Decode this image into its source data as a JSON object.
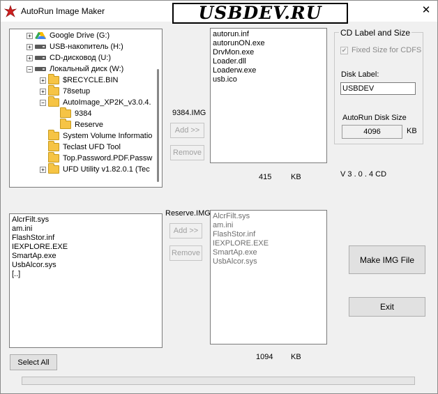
{
  "window": {
    "title": "AutoRun Image Maker",
    "logo_text": "USBDEV.RU",
    "close_symbol": "✕"
  },
  "colors": {
    "accent_red": "#cc1f1f",
    "folder": "#f6c445"
  },
  "tree": [
    {
      "label": "Google Drive (G:)",
      "icon": "google-drive-icon",
      "expander": "+"
    },
    {
      "label": "USB-накопитель (H:)",
      "icon": "usb-drive-icon",
      "expander": "+"
    },
    {
      "label": "CD-дисковод (U:)",
      "icon": "cd-drive-icon",
      "expander": "+"
    },
    {
      "label": "Локальный диск (W:)",
      "icon": "local-disk-icon",
      "expander": "-"
    },
    {
      "label": "$RECYCLE.BIN",
      "icon": "folder-icon",
      "expander": "+"
    },
    {
      "label": "78setup",
      "icon": "folder-icon",
      "expander": "+"
    },
    {
      "label": "AutoImage_XP2K_v3.0.4.",
      "icon": "folder-open-icon",
      "expander": "-"
    },
    {
      "label": "9384",
      "icon": "folder-icon",
      "expander": ""
    },
    {
      "label": "Reserve",
      "icon": "folder-icon",
      "expander": ""
    },
    {
      "label": "System Volume Informatio",
      "icon": "folder-icon",
      "expander": ""
    },
    {
      "label": "Teclast UFD Tool",
      "icon": "folder-icon",
      "expander": ""
    },
    {
      "label": "Top.Password.PDF.Passw",
      "icon": "folder-icon",
      "expander": ""
    },
    {
      "label": "UFD Utility v1.82.0.1 (Tec",
      "icon": "folder-icon",
      "expander": "+"
    }
  ],
  "top_image": {
    "label": "9384.IMG",
    "add_label": "Add >>",
    "remove_label": "Remove",
    "files": [
      "autorun.inf",
      "autorunON.exe",
      "DrvMon.exe",
      "Loader.dll",
      "Loaderw.exe",
      "usb.ico"
    ],
    "size": "415",
    "unit": "KB"
  },
  "bottom_image": {
    "label": "Reserve.IMG",
    "add_label": "Add >>",
    "remove_label": "Remove",
    "files": [
      "AlcrFilt.sys",
      "am.ini",
      "FlashStor.inf",
      "IEXPLORE.EXE",
      "SmartAp.exe",
      "UsbAlcor.sys"
    ],
    "size": "1094",
    "unit": "KB"
  },
  "source_files": [
    "AlcrFilt.sys",
    "am.ini",
    "FlashStor.inf",
    "IEXPLORE.EXE",
    "SmartAp.exe",
    "UsbAlcor.sys",
    "[..]"
  ],
  "cd_group": {
    "title": "CD Label and Size",
    "fixed_size_label": "Fixed Size for CDFS",
    "fixed_size_checked": true,
    "disk_label_caption": "Disk Label:",
    "disk_label_value": "USBDEV",
    "disk_size_caption": "AutoRun Disk Size",
    "disk_size_value": "4096",
    "disk_size_unit": "KB"
  },
  "version": "V 3 . 0 . 4 CD",
  "buttons": {
    "make_img": "Make IMG File",
    "exit": "Exit",
    "select_all": "Select All"
  },
  "progress_value": 0
}
